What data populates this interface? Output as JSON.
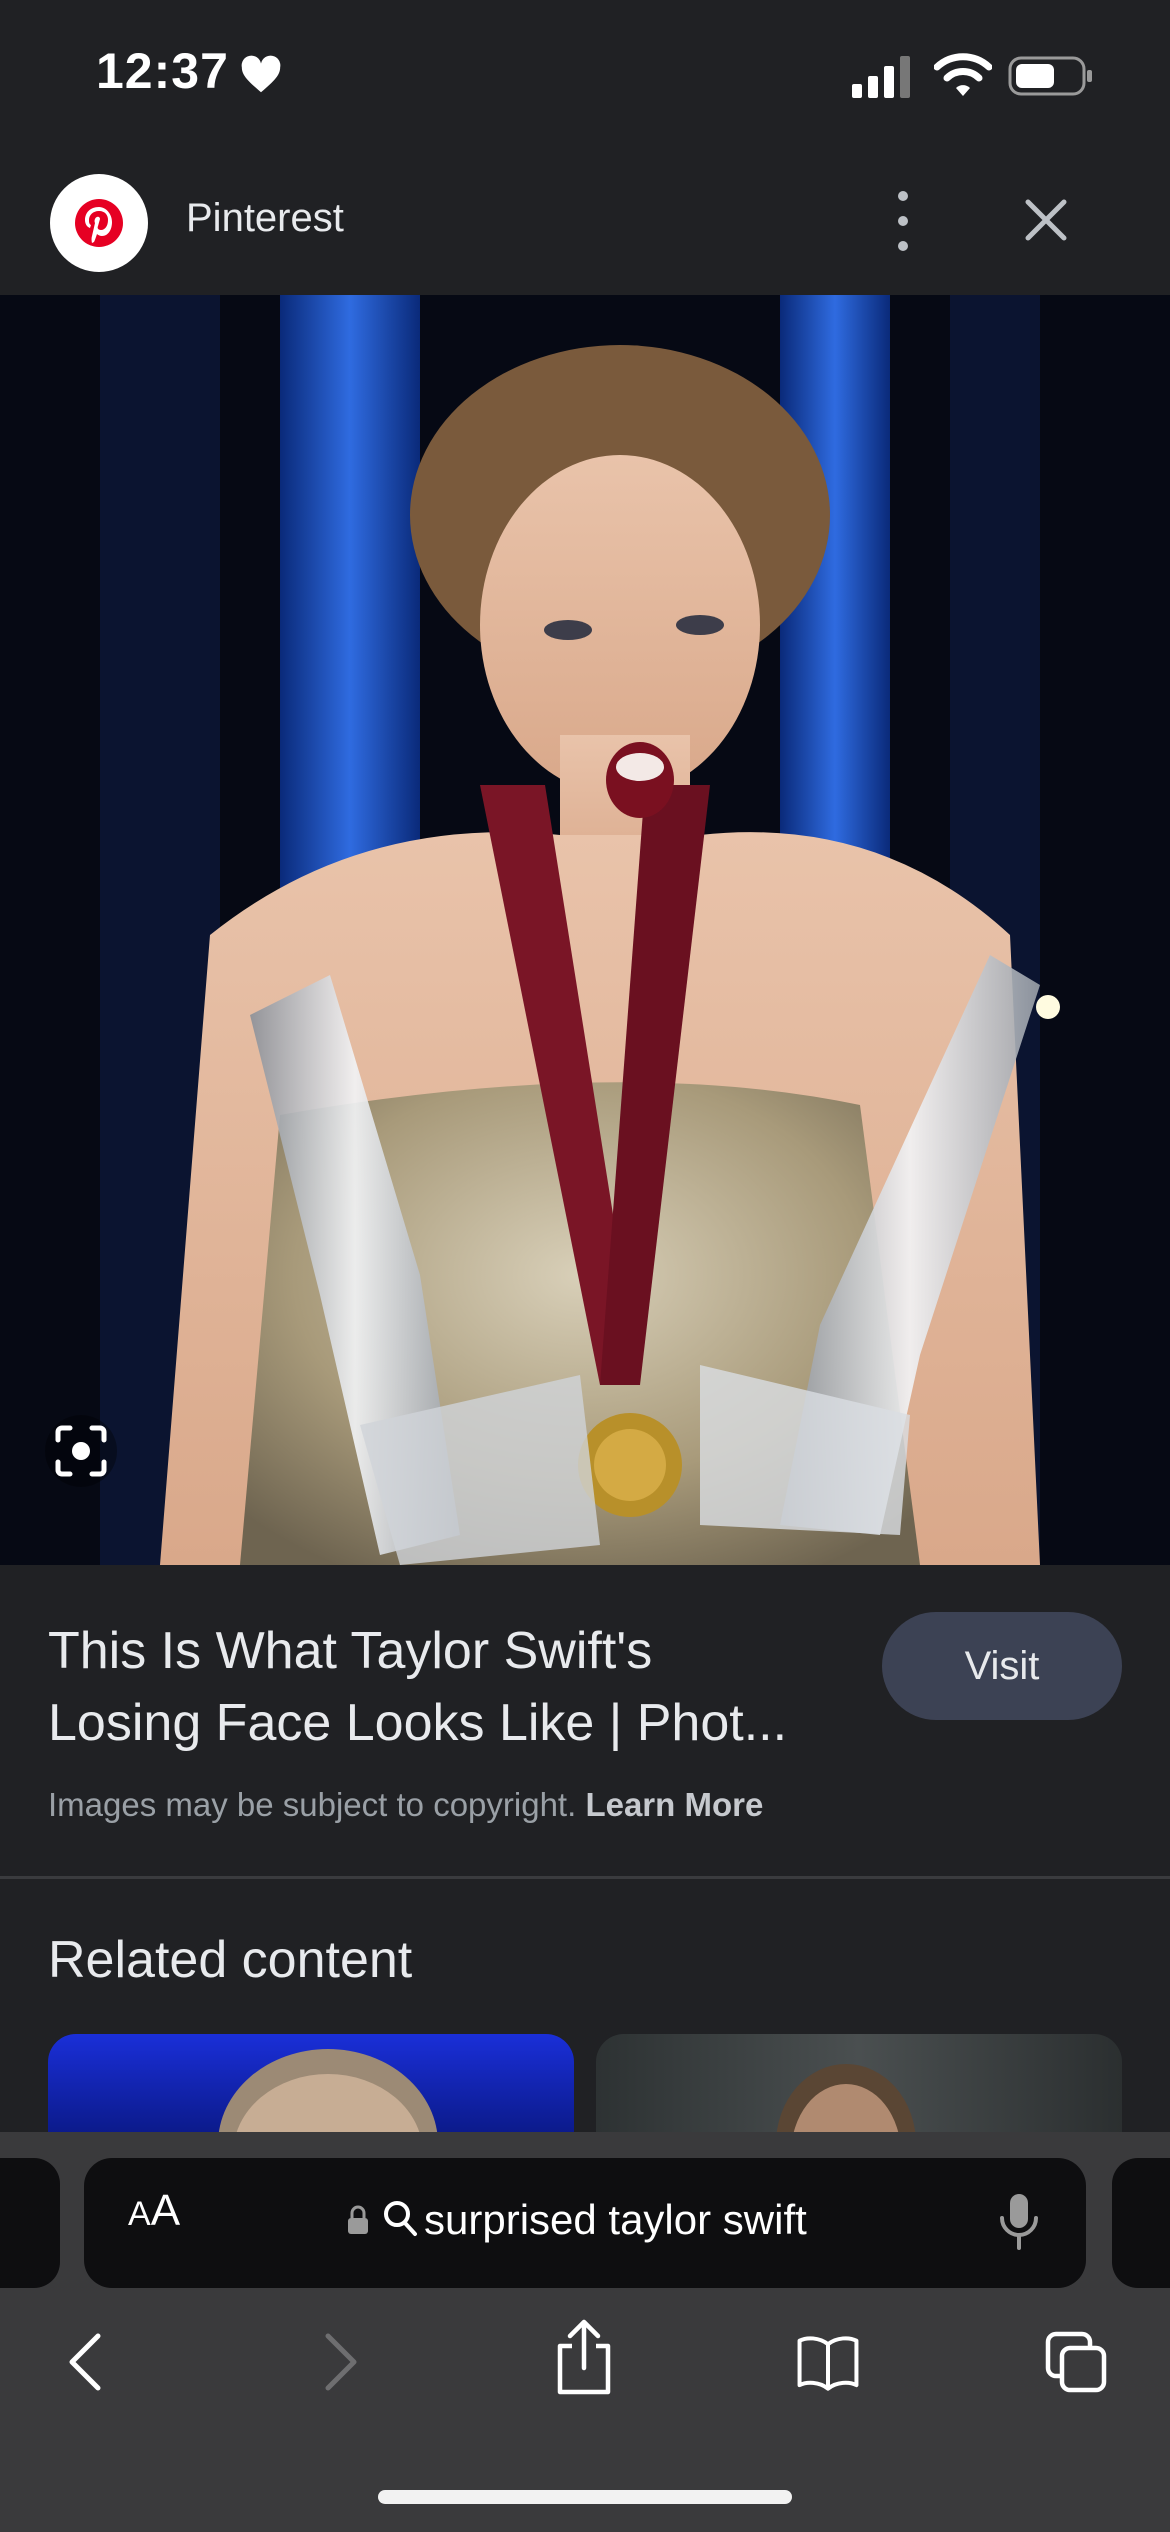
{
  "status_bar": {
    "time": "12:37",
    "icons": [
      "heart-icon",
      "signal-icon",
      "wifi-icon",
      "battery-icon"
    ]
  },
  "header": {
    "site_name": "Pinterest",
    "logo_icon": "pinterest-logo-icon",
    "more_icon": "more-vertical-icon",
    "close_icon": "close-icon"
  },
  "image": {
    "overlay_icon": "lens-icon"
  },
  "details": {
    "title_line1": "This Is What Taylor Swift's",
    "title_line2": "Losing Face Looks Like | Phot...",
    "visit_label": "Visit",
    "copyright_text": "Images may be subject to copyright.",
    "learn_more_label": "Learn More"
  },
  "related": {
    "heading": "Related content"
  },
  "browser": {
    "aa_small": "A",
    "aa_big": "A",
    "url_text": "surprised taylor swift",
    "toolbar_icons": [
      "back-icon",
      "forward-icon",
      "share-icon",
      "bookmarks-icon",
      "tabs-icon"
    ]
  },
  "colors": {
    "background": "#202124",
    "visit_button": "#3c4254",
    "pinterest_red": "#e60023",
    "chrome": "#3a3a3c"
  }
}
